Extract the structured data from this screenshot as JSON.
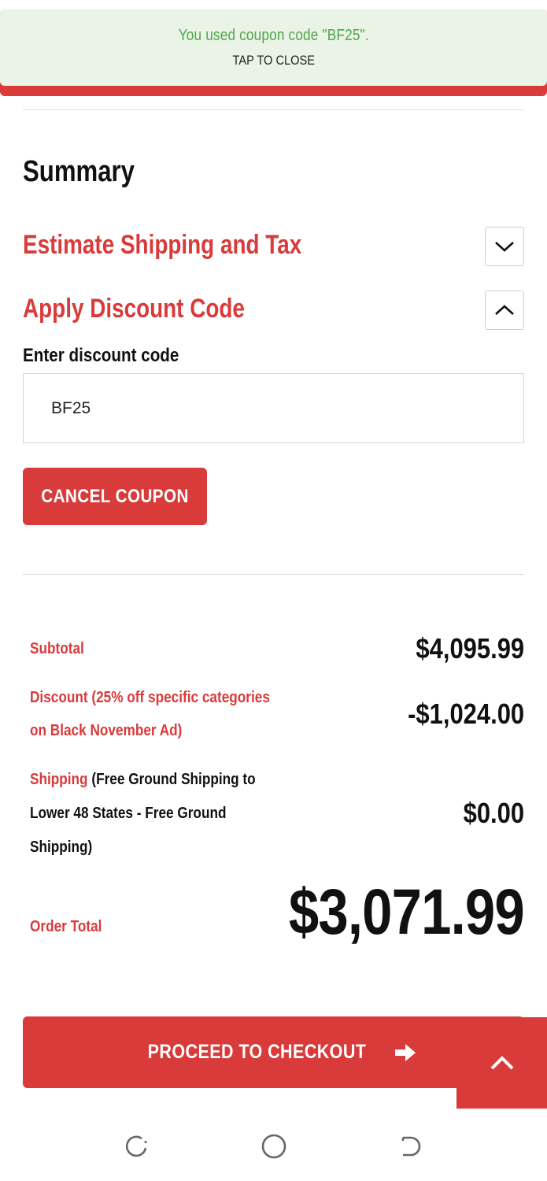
{
  "toast": {
    "message": "You used coupon code \"BF25\".",
    "close_label": "TAP TO CLOSE"
  },
  "summary": {
    "title": "Summary",
    "shipping_section": {
      "label": "Estimate Shipping and Tax",
      "icon": "chevron-down-icon"
    },
    "discount_section": {
      "label": "Apply Discount Code",
      "icon": "chevron-up-icon"
    },
    "discount_field": {
      "label": "Enter discount code",
      "value": "BF25"
    },
    "cancel_button": "CANCEL COUPON"
  },
  "totals": {
    "subtotal": {
      "label": "Subtotal",
      "value": "$4,095.99"
    },
    "discount": {
      "label_line1": "Discount (25% off specific categories",
      "label_line2": "on Black November Ad)",
      "value": "-$1,024.00"
    },
    "shipping": {
      "label": "Shipping",
      "detail_line1": "(Free Ground Shipping to",
      "detail_line2": "Lower 48 States - Free Ground",
      "detail_line3": "Shipping)",
      "value": "$0.00"
    },
    "order_total": {
      "label": "Order Total",
      "value": "$3,071.99"
    }
  },
  "checkout": {
    "label": "PROCEED TO CHECKOUT",
    "icon": "arrow-right-icon"
  },
  "scroll_top": {
    "icon": "chevron-up-icon"
  },
  "colors": {
    "accent": "#d93a3a",
    "toast_bg": "#e9f3e6",
    "toast_text": "#4fa64b"
  },
  "system_nav": {
    "recent": "recent-apps-icon",
    "home": "home-icon",
    "back": "back-icon"
  }
}
